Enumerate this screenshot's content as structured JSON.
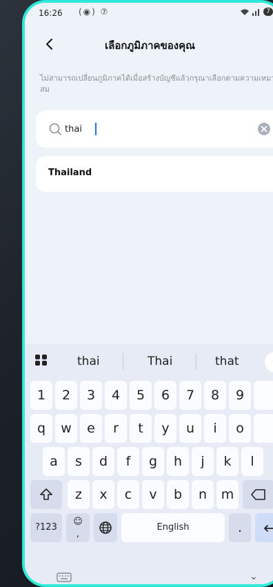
{
  "status": {
    "time": "16:26",
    "icons": "(◉) ⑦",
    "right": "7"
  },
  "header": {
    "title": "เลือกภูมิภาคของคุณ"
  },
  "hint": "ไม่สามารถเปลี่ยนภูมิภาคได้เมื่อสร้างบัญชีแล้วกรุณาเลือกตามความเหมาะสม",
  "search": {
    "value": "thai",
    "placeholder": ""
  },
  "results": [
    {
      "label": "Thailand"
    }
  ],
  "keyboard": {
    "suggestions": [
      "thai",
      "Thai",
      "that"
    ],
    "numbers": [
      "1",
      "2",
      "3",
      "4",
      "5",
      "6",
      "7",
      "8",
      "9"
    ],
    "row1": [
      "q",
      "w",
      "e",
      "r",
      "t",
      "y",
      "u",
      "i",
      "o"
    ],
    "row2": [
      "a",
      "s",
      "d",
      "f",
      "g",
      "h",
      "j",
      "k",
      "l"
    ],
    "row3": [
      "z",
      "x",
      "c",
      "v",
      "b",
      "n",
      "m"
    ],
    "symbols_label": "?123",
    "emoji_label": "☺",
    "comma_label": ",",
    "space_label": "English",
    "period_label": "."
  }
}
